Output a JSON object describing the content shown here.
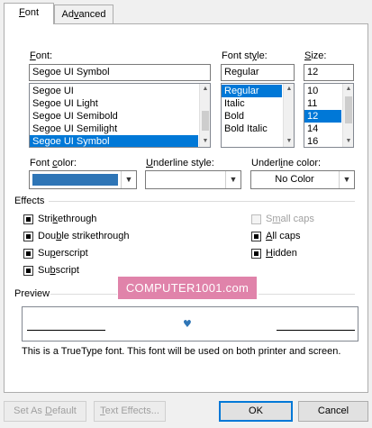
{
  "tabs": [
    {
      "label_pre": "",
      "label_hot": "F",
      "label_post": "ont"
    },
    {
      "label_pre": "Ad",
      "label_hot": "v",
      "label_post": "anced"
    }
  ],
  "font": {
    "label_hot": "F",
    "label_post": "ont:",
    "value": "Segoe UI Symbol",
    "items": [
      "Segoe UI",
      "Segoe UI Light",
      "Segoe UI Semibold",
      "Segoe UI Semilight",
      "Segoe UI Symbol"
    ],
    "selected_index": 4
  },
  "font_style": {
    "label_pre": "Font st",
    "label_hot": "y",
    "label_post": "le:",
    "value": "Regular",
    "items": [
      "Regular",
      "Italic",
      "Bold",
      "Bold Italic"
    ],
    "selected_index": 0
  },
  "size": {
    "label_hot": "S",
    "label_post": "ize:",
    "value": "12",
    "items": [
      "10",
      "11",
      "12",
      "14",
      "16"
    ],
    "selected_index": 2
  },
  "font_color": {
    "label_pre": "Font ",
    "label_hot": "c",
    "label_post": "olor:",
    "swatch_color": "#2e75b6"
  },
  "underline_style": {
    "label_hot": "U",
    "label_post": "nderline style:",
    "value": ""
  },
  "underline_color": {
    "label_pre": "Underl",
    "label_hot": "i",
    "label_post": "ne color:",
    "value": "No Color"
  },
  "effects": {
    "title": "Effects",
    "left": [
      {
        "pre": "Stri",
        "hot": "k",
        "post": "ethrough",
        "checked": true
      },
      {
        "pre": "Dou",
        "hot": "b",
        "post": "le strikethrough",
        "checked": true
      },
      {
        "pre": "Su",
        "hot": "p",
        "post": "erscript",
        "checked": true
      },
      {
        "pre": "Su",
        "hot": "b",
        "post": "script",
        "checked": true
      }
    ],
    "right": [
      {
        "pre": "S",
        "hot": "m",
        "post": "all caps",
        "checked": false,
        "disabled": true
      },
      {
        "pre": "",
        "hot": "A",
        "post": "ll caps",
        "checked": true,
        "disabled": false
      },
      {
        "pre": "",
        "hot": "H",
        "post": "idden",
        "checked": true,
        "disabled": false
      }
    ]
  },
  "watermark": "COMPUTER1001.com",
  "preview": {
    "title": "Preview",
    "glyph": "♥",
    "glyph_color": "#2e75b6",
    "note": "This is a TrueType font. This font will be used on both printer and screen."
  },
  "buttons": {
    "set_default_pre": "Set As ",
    "set_default_hot": "D",
    "set_default_post": "efault",
    "text_effects_pre": "T",
    "text_effects_hot": "e",
    "text_effects_post": "xt Effects...",
    "ok": "OK",
    "cancel": "Cancel"
  }
}
